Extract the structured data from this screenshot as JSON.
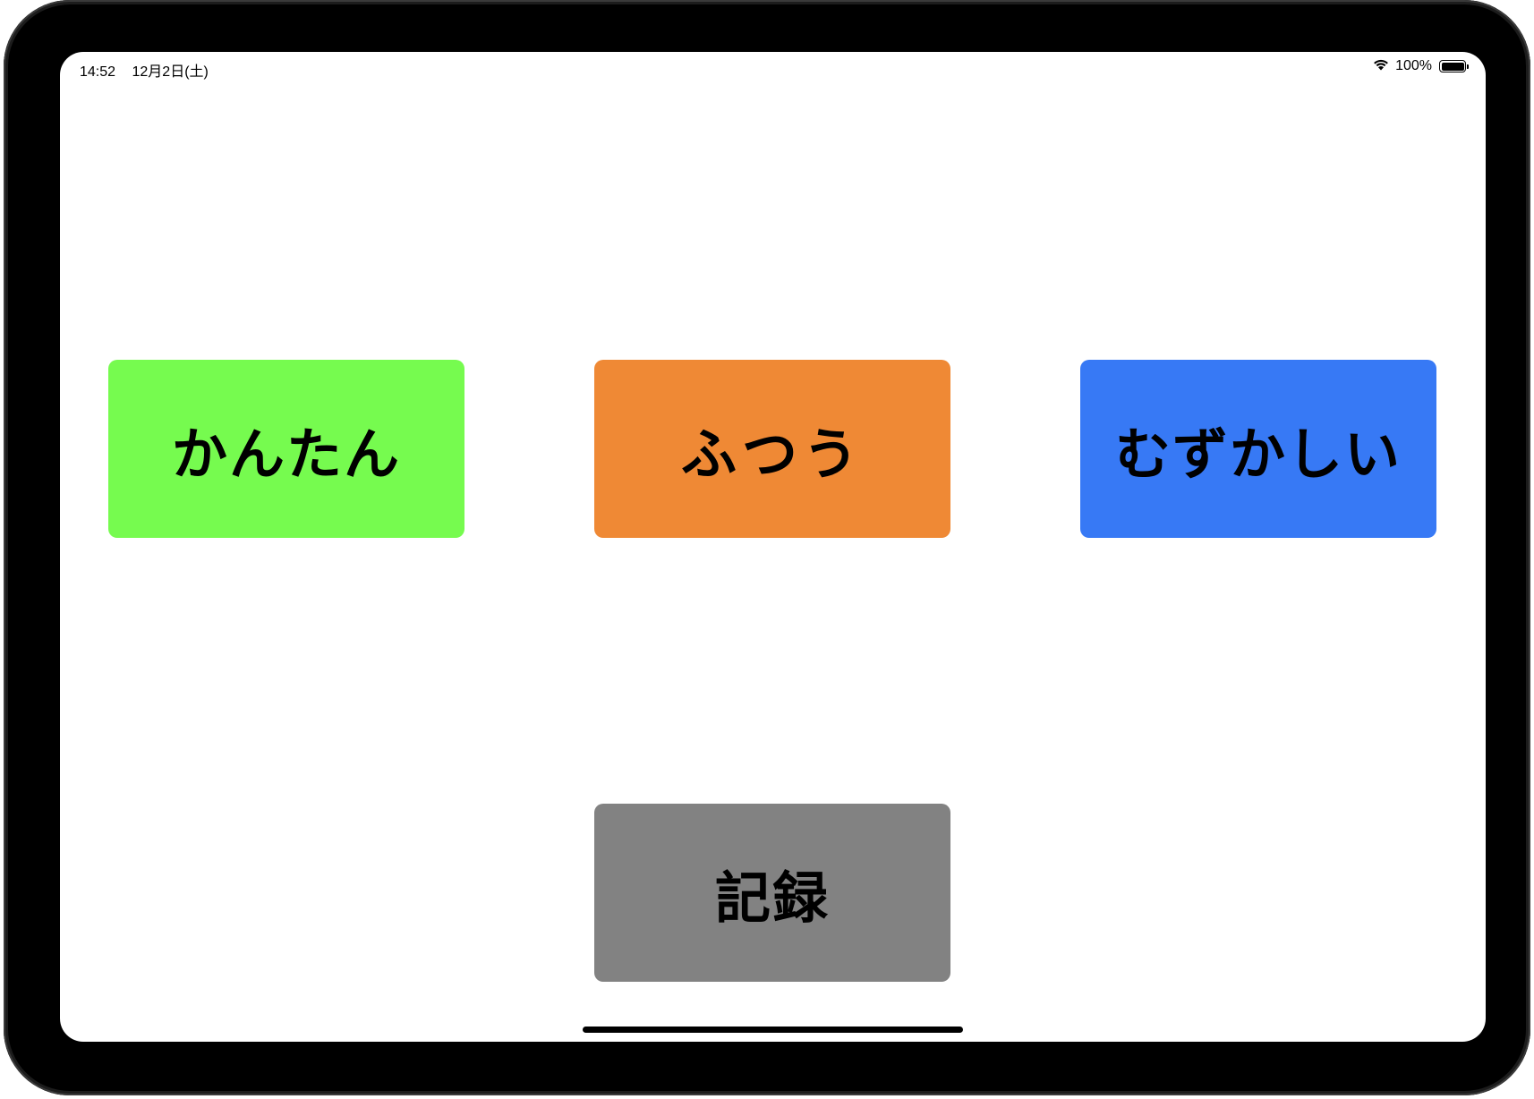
{
  "status_bar": {
    "time": "14:52",
    "date": "12月2日(土)",
    "battery_text": "100%",
    "battery_level": 1.0
  },
  "buttons": {
    "easy": {
      "label": "かんたん",
      "color": "#76fb4f"
    },
    "normal": {
      "label": "ふつう",
      "color": "#ef8935"
    },
    "hard": {
      "label": "むずかしい",
      "color": "#3779f5"
    },
    "record": {
      "label": "記録",
      "color": "#828282"
    }
  },
  "icons": {
    "wifi": "wifi-icon",
    "battery": "battery-icon"
  }
}
